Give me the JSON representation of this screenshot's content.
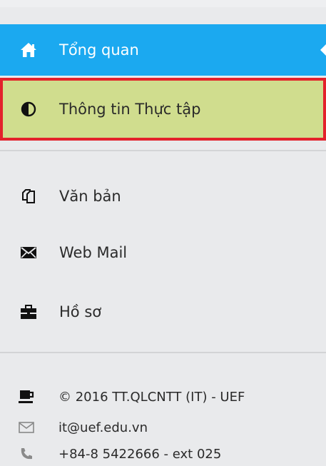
{
  "menu": {
    "overview": {
      "label": "Tổng quan",
      "icon": "home-icon"
    },
    "internship": {
      "label": "Thông tin Thực tập",
      "icon": "half-circle-icon"
    },
    "documents": {
      "label": "Văn bản",
      "icon": "documents-icon"
    },
    "webmail": {
      "label": "Web Mail",
      "icon": "envelope-icon"
    },
    "profile": {
      "label": "Hồ sơ",
      "icon": "briefcase-icon"
    }
  },
  "footer": {
    "copyright": "© 2016 TT.QLCNTT (IT) - UEF",
    "email": "it@uef.edu.vn",
    "phone": "+84-8 5422666 - ext 025"
  },
  "colors": {
    "active_blue": "#1ba9f0",
    "highlight_green": "#d0dd8e",
    "highlight_border": "#e3222b",
    "background": "#e9eaec"
  }
}
